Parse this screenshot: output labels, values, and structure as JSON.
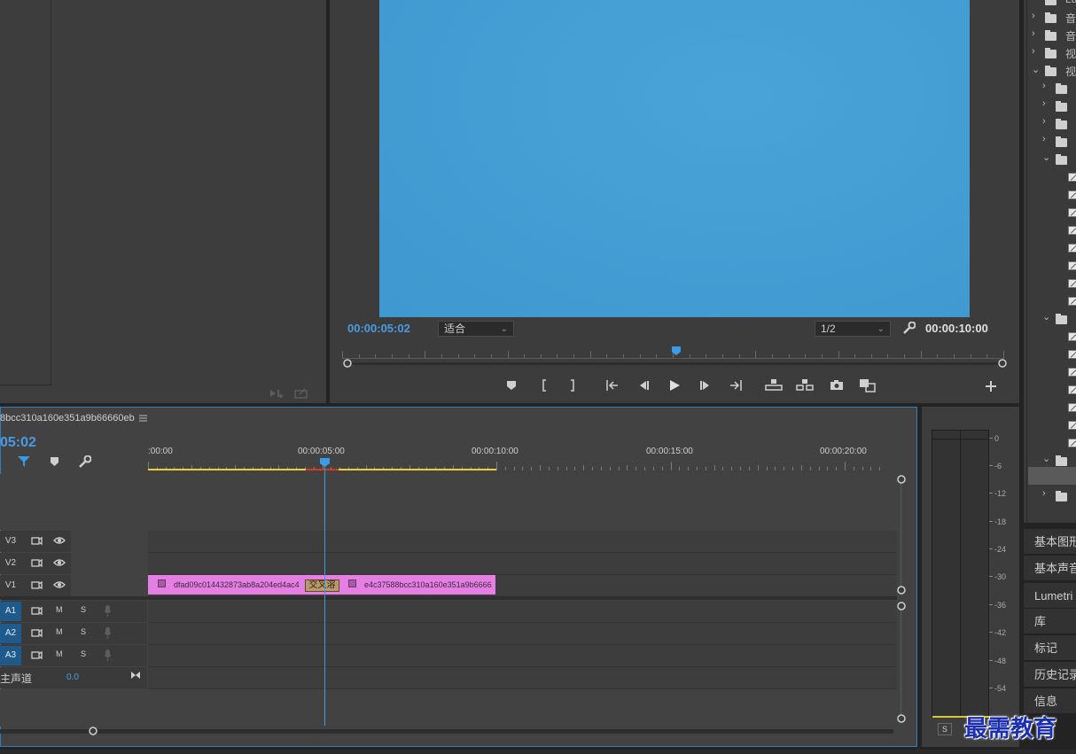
{
  "program_monitor": {
    "current_time": "00:00:05:02",
    "fit_label": "适合",
    "resolution": "1/2",
    "duration": "00:00:10:00"
  },
  "project_tree": {
    "rows": [
      {
        "label": "Lu"
      },
      {
        "label": "音"
      },
      {
        "label": "音"
      },
      {
        "label": "视"
      },
      {
        "label": "视"
      }
    ]
  },
  "side_panels": [
    {
      "label": "基本图形"
    },
    {
      "label": "基本声音"
    },
    {
      "label": "Lumetri 颜"
    },
    {
      "label": "库"
    },
    {
      "label": "标记"
    },
    {
      "label": "历史记录"
    },
    {
      "label": "信息"
    }
  ],
  "timeline": {
    "sequence_name": "8bcc310a160e351a9b66660eb",
    "timecode": "05:02",
    "ruler_labels": [
      ":00:00",
      "00:00:05:00",
      "00:00:10:00",
      "00:00:15:00",
      "00:00:20:00"
    ],
    "tracks": {
      "video": [
        "V3",
        "V2",
        "V1"
      ],
      "audio": [
        "A1",
        "A2",
        "A3"
      ],
      "master_label": "主声道",
      "master_value": "0.0",
      "m_label": "M",
      "s_label": "S"
    },
    "clips": {
      "clip1_name": "dfad09c014432873ab8a204ed4ac4",
      "transition_label": "交叉溶",
      "clip2_name": "e4c37588bcc310a160e351a9b6666",
      "color": "#e67fe3"
    },
    "menu_icon": "hamburger-icon"
  },
  "audio_meter": {
    "db_labels": [
      "0",
      "-6",
      "-12",
      "-18",
      "-24",
      "-30",
      "-36",
      "-42",
      "-48",
      "-54"
    ],
    "solo_label": "S"
  },
  "watermark": "最需教育",
  "colors": {
    "accent_blue": "#3a9be8",
    "timecode_blue": "#4b9be3",
    "clip_pink": "#e67fe3",
    "work_area_yellow": "#e6d13a"
  }
}
